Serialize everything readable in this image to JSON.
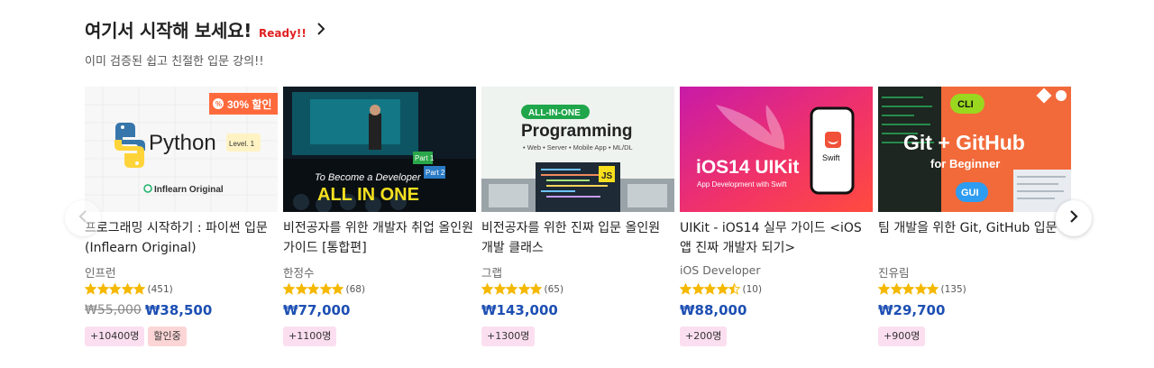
{
  "section": {
    "title": "여기서 시작해 보세요!",
    "ready": "Ready!!",
    "subtitle": "이미 검증된 쉽고 친절한 입문 강의!!"
  },
  "icons": {
    "chevron_right": "chevron-right-icon",
    "arrow_prev": "chevron-left-icon",
    "arrow_next": "chevron-right-icon",
    "star": "star-icon"
  },
  "colors": {
    "price": "#1d4fb3",
    "star": "#f5b800",
    "ready": "#e02020",
    "discount_badge": "#ff6a3d"
  },
  "courses": [
    {
      "title": "프로그래밍 시작하기 : 파이썬 입문 (Inflearn Original)",
      "instructor": "인프런",
      "rating": 5,
      "rating_count": "(451)",
      "original_price": "₩55,000",
      "price": "₩38,500",
      "tags": [
        "+10400명",
        "할인중"
      ],
      "thumb": {
        "badge": "30% 할인",
        "main": "Python",
        "level": "Level. 1",
        "brand": "Inflearn Original"
      }
    },
    {
      "title": "비전공자를 위한 개발자 취업 올인원 가이드 [통합편]",
      "instructor": "한정수",
      "rating": 5,
      "rating_count": "(68)",
      "original_price": "",
      "price": "₩77,000",
      "tags": [
        "+1100명"
      ],
      "thumb": {
        "line1": "To Become a Developer",
        "line2": "ALL IN ONE",
        "part1": "Part 1",
        "part2": "Part 2"
      }
    },
    {
      "title": "비전공자를 위한 진짜 입문 올인원 개발 클래스",
      "instructor": "그랩",
      "rating": 5,
      "rating_count": "(65)",
      "original_price": "",
      "price": "₩143,000",
      "tags": [
        "+1300명"
      ],
      "thumb": {
        "pill": "ALL-IN-ONE",
        "main": "Programming",
        "sub": "• Web • Server • Mobile App • ML/DL",
        "js": "JS"
      }
    },
    {
      "title": "UIKit - iOS14 실무 가이드 <iOS앱 진짜 개발자 되기>",
      "instructor": "iOS Developer",
      "rating": 4.5,
      "rating_count": "(10)",
      "original_price": "",
      "price": "₩88,000",
      "tags": [
        "+200명"
      ],
      "thumb": {
        "main": "iOS14 UIKit",
        "sub": "App Development with Swift",
        "phone_label": "Swift"
      }
    },
    {
      "title": "팀 개발을 위한 Git, GitHub 입문",
      "instructor": "진유림",
      "rating": 5,
      "rating_count": "(135)",
      "original_price": "",
      "price": "₩29,700",
      "tags": [
        "+900명"
      ],
      "thumb": {
        "cli": "CLI",
        "main": "Git + GitHub",
        "sub": "for Beginner",
        "gui": "GUI"
      }
    }
  ]
}
